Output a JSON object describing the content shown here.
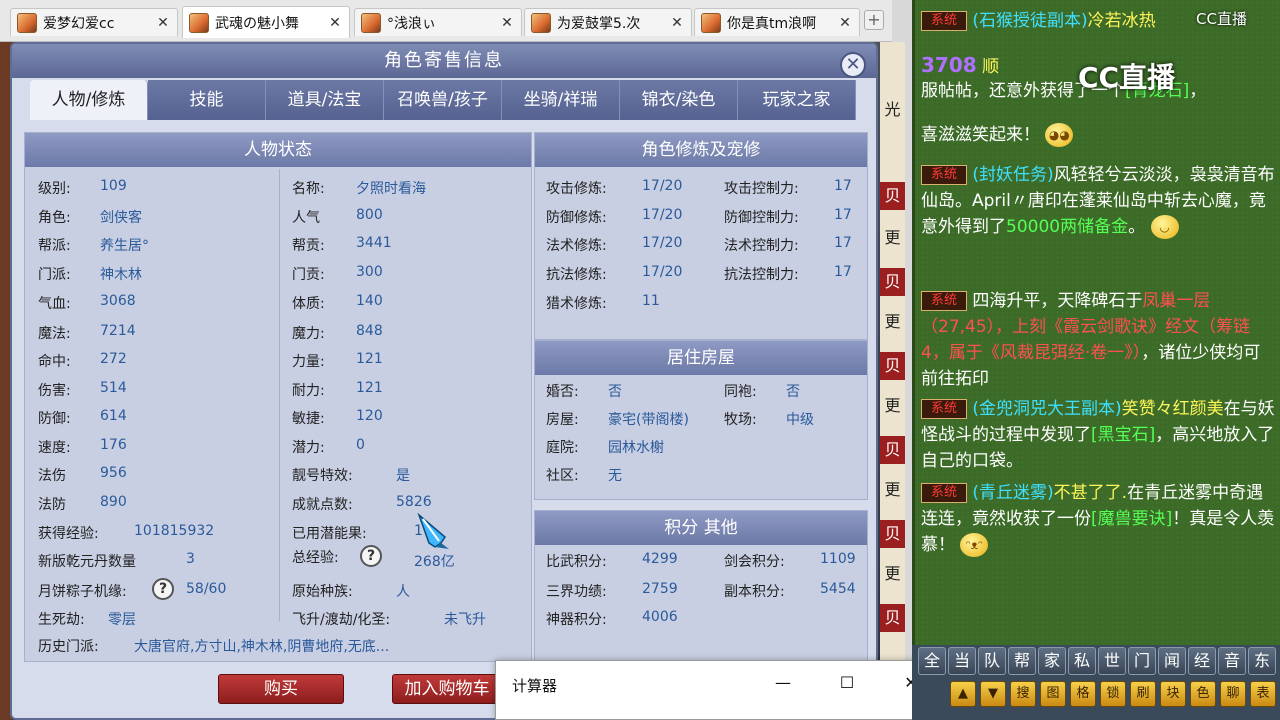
{
  "browser_tabs": [
    {
      "label": "爱梦幻爱cc",
      "active": false
    },
    {
      "label": "武魂の魅小舞",
      "active": true
    },
    {
      "label": "°浅浪ぃ",
      "active": false
    },
    {
      "label": "为爱鼓掌5.次",
      "active": false
    },
    {
      "label": "你是真tm浪啊",
      "active": false
    }
  ],
  "panel": {
    "title": "角色寄售信息",
    "tabs": [
      "人物/修炼",
      "技能",
      "道具/法宝",
      "召唤兽/孩子",
      "坐骑/祥瑞",
      "锦衣/染色",
      "玩家之家"
    ],
    "buy_label": "购买",
    "cart_label": "加入购物车"
  },
  "status": {
    "title": "人物状态",
    "left": [
      {
        "label": "级别:",
        "value": "109"
      },
      {
        "label": "角色:",
        "value": "剑侠客"
      },
      {
        "label": "帮派:",
        "value": "养生居°"
      },
      {
        "label": "门派:",
        "value": "神木林"
      },
      {
        "label": "气血:",
        "value": "3068"
      },
      {
        "label": "魔法:",
        "value": "7214"
      },
      {
        "label": "命中:",
        "value": "272"
      },
      {
        "label": "伤害:",
        "value": "514"
      },
      {
        "label": "防御:",
        "value": "614"
      },
      {
        "label": "速度:",
        "value": "176"
      },
      {
        "label": "法伤",
        "value": "956"
      },
      {
        "label": "法防",
        "value": "890"
      }
    ],
    "right": [
      {
        "label": "名称:",
        "value": "夕照时看海"
      },
      {
        "label": "人气",
        "value": "800"
      },
      {
        "label": "帮贡:",
        "value": "3441"
      },
      {
        "label": "门贡:",
        "value": "300"
      },
      {
        "label": "体质:",
        "value": "140"
      },
      {
        "label": "魔力:",
        "value": "848"
      },
      {
        "label": "力量:",
        "value": "121"
      },
      {
        "label": "耐力:",
        "value": "121"
      },
      {
        "label": "敏捷:",
        "value": "120"
      },
      {
        "label": "潜力:",
        "value": "0"
      },
      {
        "label": "靓号特效:",
        "value": "是"
      },
      {
        "label": "成就点数:",
        "value": "5826"
      }
    ],
    "exp_label": "获得经验:",
    "exp_value": "101815932",
    "dan_label": "新版乾元丹数量",
    "dan_value": "3",
    "potential_label": "已用潜能果:",
    "potential_value": "1",
    "zongzi_label": "月饼粽子机缘:",
    "zongzi_value": "58/60",
    "total_exp_label": "总经验:",
    "total_exp_value": "268亿",
    "birth_label": "生死劫:",
    "birth_value": "零层",
    "race_label": "原始种族:",
    "race_value": "人",
    "fly_label": "飞升/渡劫/化圣:",
    "fly_value": "未飞升",
    "history_label": "历史门派:",
    "history_value": "大唐官府,方寸山,神木林,阴曹地府,无底..."
  },
  "cultivation": {
    "title": "角色修炼及宠修",
    "rows": [
      {
        "a_label": "攻击修炼:",
        "a_value": "17/20",
        "b_label": "攻击控制力:",
        "b_value": "17"
      },
      {
        "a_label": "防御修炼:",
        "a_value": "17/20",
        "b_label": "防御控制力:",
        "b_value": "17"
      },
      {
        "a_label": "法术修炼:",
        "a_value": "17/20",
        "b_label": "法术控制力:",
        "b_value": "17"
      },
      {
        "a_label": "抗法修炼:",
        "a_value": "17/20",
        "b_label": "抗法控制力:",
        "b_value": "17"
      },
      {
        "a_label": "猎术修炼:",
        "a_value": "11",
        "b_label": "",
        "b_value": ""
      }
    ]
  },
  "housing": {
    "title": "居住房屋",
    "rows": [
      {
        "a_label": "婚否:",
        "a_value": "否",
        "b_label": "同袍:",
        "b_value": "否"
      },
      {
        "a_label": "房屋:",
        "a_value": "豪宅(带阁楼)",
        "b_label": "牧场:",
        "b_value": "中级"
      },
      {
        "a_label": "庭院:",
        "a_value": "园林水榭",
        "b_label": "",
        "b_value": ""
      },
      {
        "a_label": "社区:",
        "a_value": "无",
        "b_label": "",
        "b_value": ""
      }
    ]
  },
  "points": {
    "title": "积分 其他",
    "rows": [
      {
        "a_label": "比武积分:",
        "a_value": "4299",
        "b_label": "剑会积分:",
        "b_value": "1109"
      },
      {
        "a_label": "三界功绩:",
        "a_value": "2759",
        "b_label": "副本积分:",
        "b_value": "5454"
      },
      {
        "a_label": "神器积分:",
        "a_value": "4006",
        "b_label": "",
        "b_value": ""
      }
    ]
  },
  "calculator": {
    "title": "计算器",
    "minimize": "—",
    "maximize": "☐",
    "close": "✕"
  },
  "chat": {
    "logo": "CC直播",
    "logo_small": "CC直播",
    "sys_badge": "系统",
    "messages": {
      "m1_a": "(石猴授徒副本)",
      "m1_b": "冷若冰热",
      "m2_a": "3708",
      "m2_b": "顺",
      "m3_a": "服帖帖，还意外获得了一个",
      "m3_b": "[青龙石]",
      "m3_c": "，",
      "m4": "喜滋滋笑起来！",
      "m5_a": "(封妖任务)",
      "m5_b": "风轻轻兮云淡淡，袅袅清音布仙岛。April〃唐印在蓬莱仙岛中斩去心魔，竟意外得到了",
      "m5_c": "50000两储备金",
      "m5_d": "。",
      "m6_a": "四海升平，天降碑石于",
      "m6_b": "凤巢一层（27,45），上刻《霞云剑歌诀》经文（筹链4，属于《风裁昆弭经·卷一》）",
      "m6_c": "，诸位少侠均可前往拓印",
      "m7_a": "(金兜洞兕大王副本)",
      "m7_b": "笑赞々红颜美",
      "m7_c": "在与妖怪战斗的过程中发现了",
      "m7_d": "[黑宝石]",
      "m7_e": "，高兴地放入了自己的口袋。",
      "m8_a": "(青丘迷雾)",
      "m8_b": "不甚了了.",
      "m8_c": "在青丘迷雾中奇遇连连，竟然收获了一份",
      "m8_d": "[魔兽要诀]",
      "m8_e": "！真是令人羡慕！"
    },
    "toolbar_row1": [
      "全",
      "当",
      "队",
      "帮",
      "家",
      "私",
      "世",
      "门",
      "闻",
      "经",
      "音",
      "东"
    ],
    "toolbar_row2": [
      "▲",
      "▼",
      "搜",
      "图",
      "格",
      "锁",
      "刷",
      "块",
      "色",
      "聊",
      "表",
      "↘"
    ]
  },
  "right_strip": [
    "贝",
    "更",
    "贝",
    "更",
    "贝",
    "更",
    "贝",
    "更",
    "贝",
    "更",
    "贝",
    "光"
  ]
}
